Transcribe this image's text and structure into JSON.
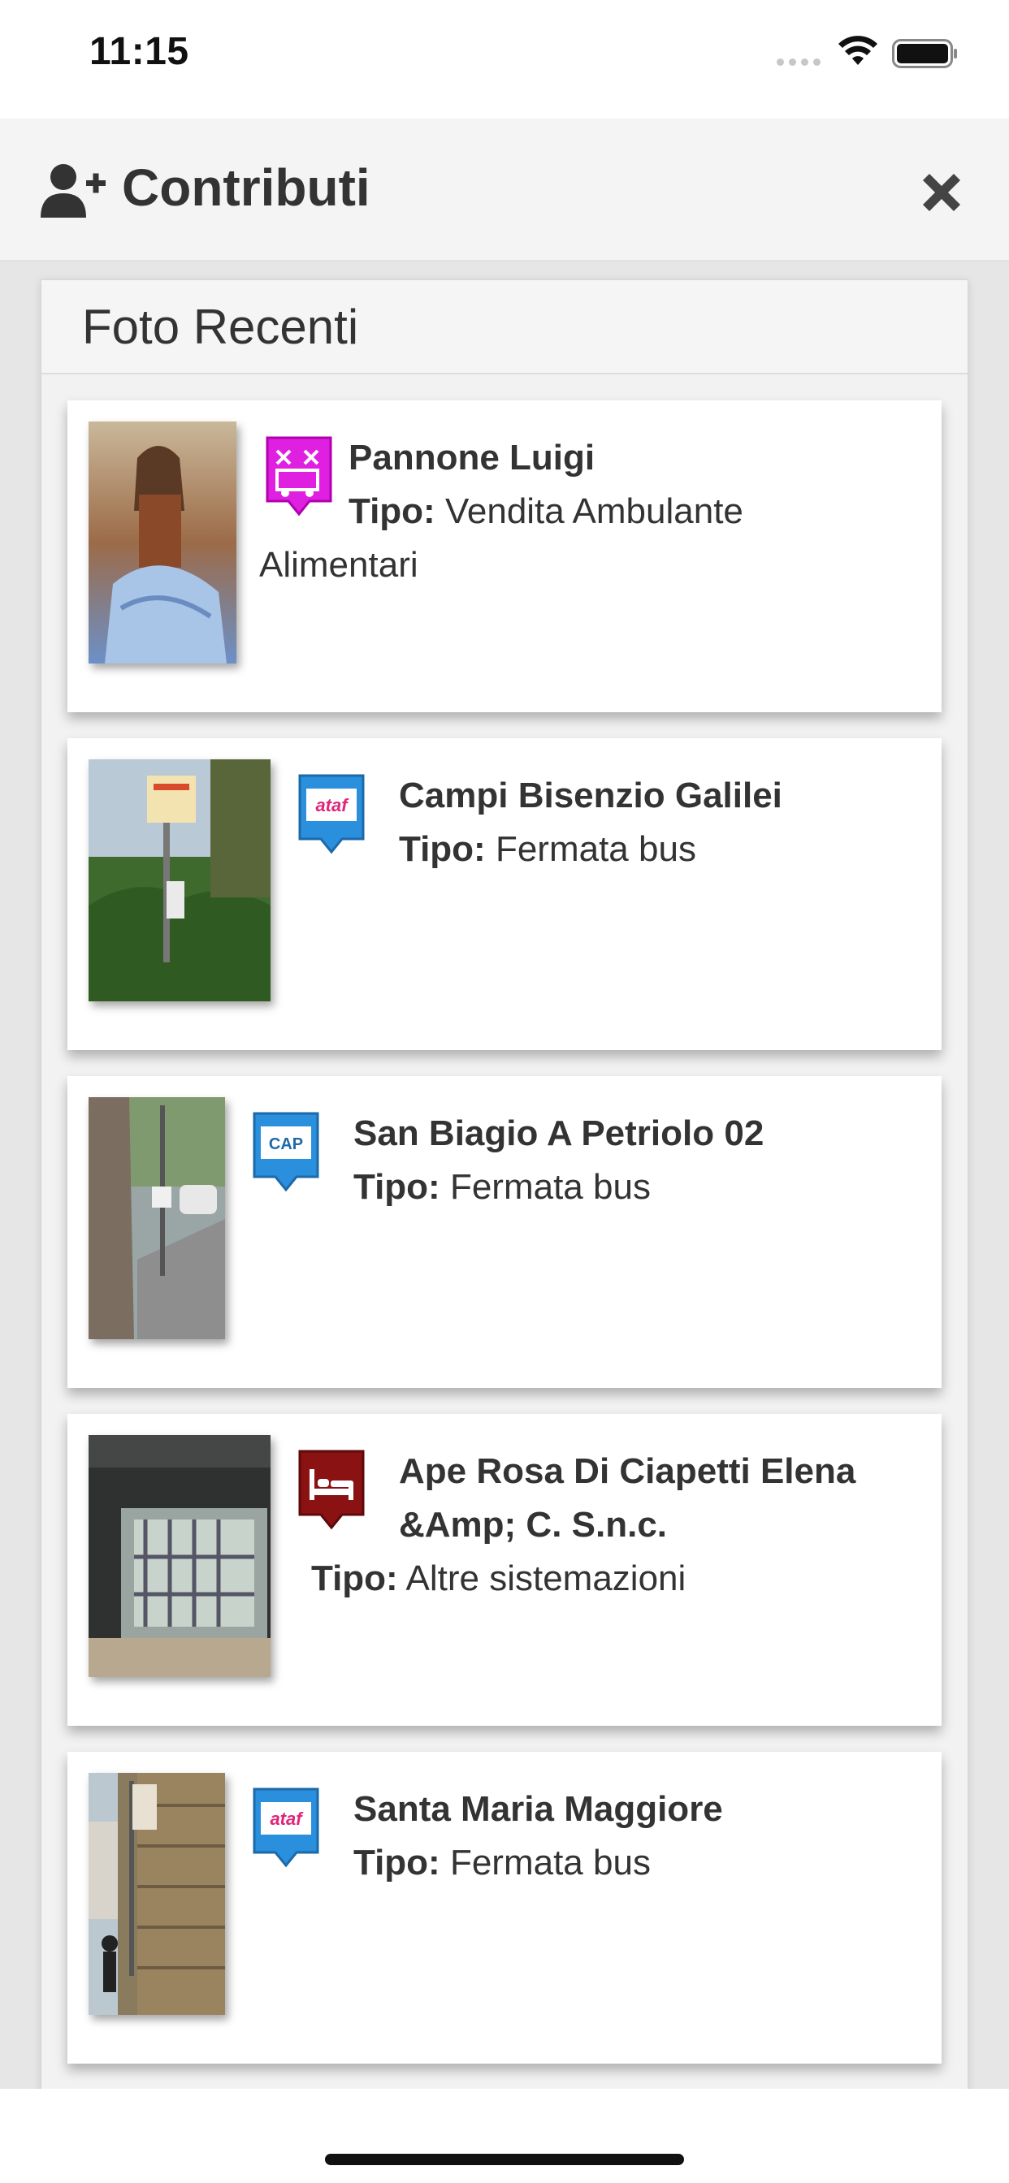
{
  "status_bar": {
    "time": "11:15"
  },
  "header": {
    "title": "Contributi",
    "icon": "user-plus-icon",
    "close_icon": "close-icon"
  },
  "panel": {
    "title": "Foto Recenti"
  },
  "tipo_label": "Tipo:",
  "items": [
    {
      "name": "Pannone Luigi",
      "tipo": "Vendita Ambulante Alimentari",
      "marker_icon": "street-vendor-icon",
      "marker_color": "#e020e0"
    },
    {
      "name": "Campi Bisenzio Galilei",
      "tipo": "Fermata bus",
      "marker_icon": "ataf-bus-icon",
      "marker_color": "#2a8fdc"
    },
    {
      "name": "San Biagio A Petriolo 02",
      "tipo": "Fermata bus",
      "marker_icon": "cap-bus-icon",
      "marker_color": "#2a8fdc"
    },
    {
      "name": "Ape Rosa Di Ciapetti Elena &Amp; C. S.n.c.",
      "tipo": "Altre sistemazioni",
      "marker_icon": "bed-icon",
      "marker_color": "#8b1212"
    },
    {
      "name": "Santa Maria Maggiore",
      "tipo": "Fermata bus",
      "marker_icon": "ataf-bus-icon",
      "marker_color": "#2a8fdc"
    }
  ]
}
